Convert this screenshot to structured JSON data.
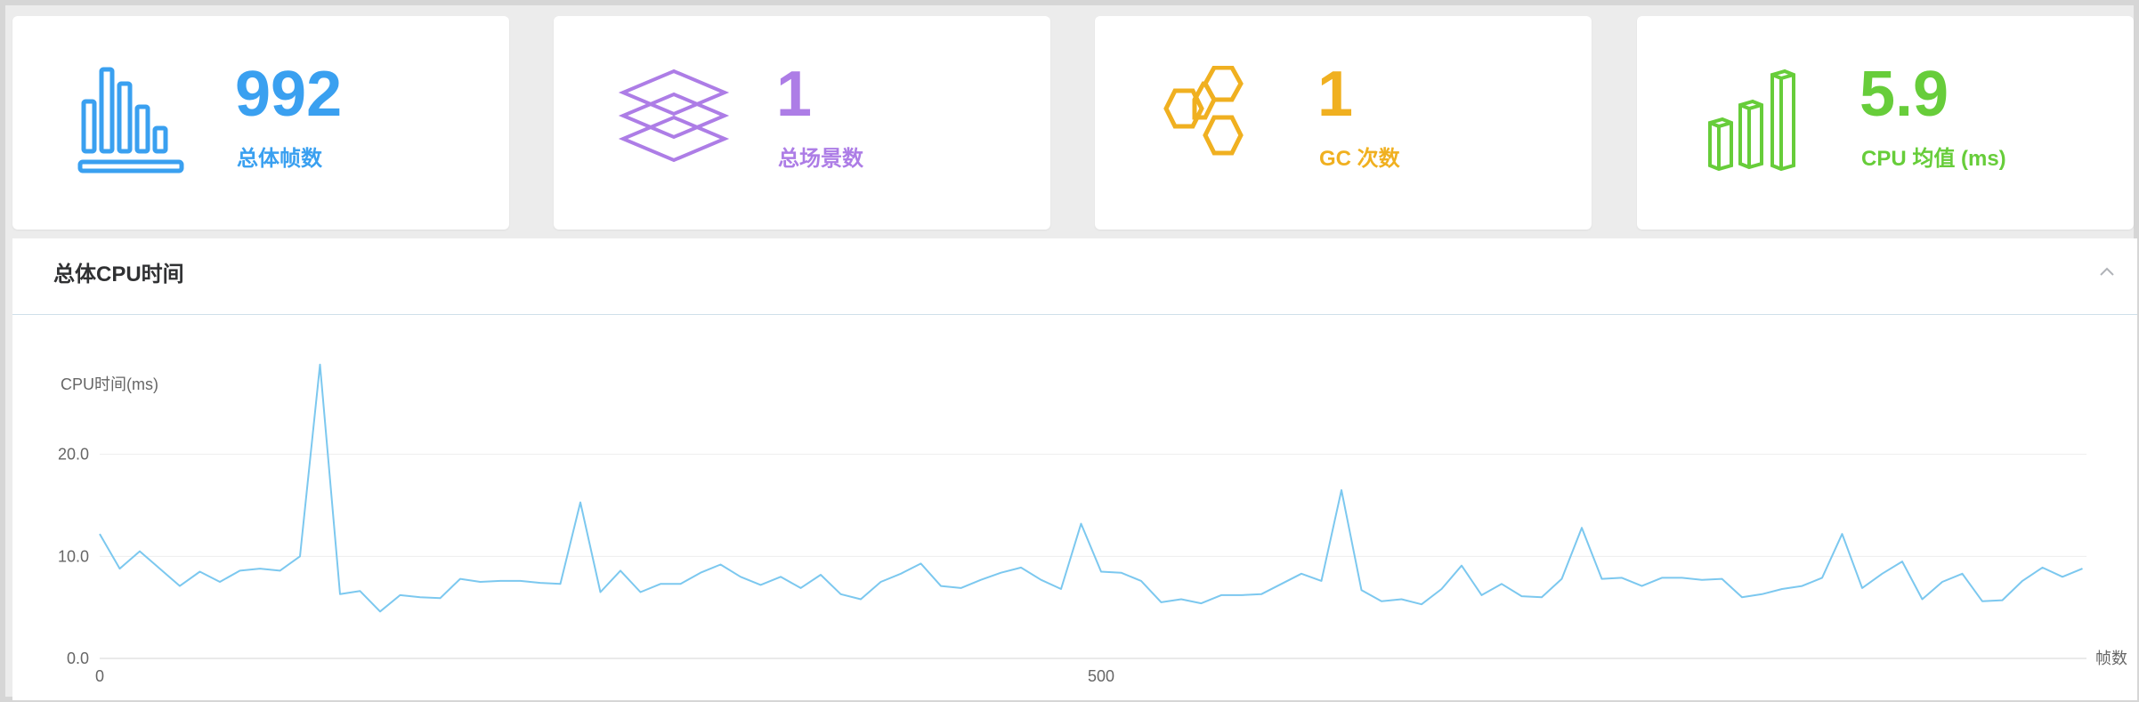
{
  "colors": {
    "blue": "#3aa0f0",
    "purple": "#ad7de6",
    "orange": "#f0b020",
    "green": "#67cd3a",
    "line": "#7cc8ef"
  },
  "stats": [
    {
      "value": "992",
      "label": "总体帧数",
      "icon": "bar-chart-icon",
      "color": "#3aa0f0"
    },
    {
      "value": "1",
      "label": "总场景数",
      "icon": "layers-icon",
      "color": "#ad7de6"
    },
    {
      "value": "1",
      "label": "GC 次数",
      "icon": "hexagons-icon",
      "color": "#f0b020"
    },
    {
      "value": "5.9",
      "label": "CPU 均值 (ms)",
      "icon": "3d-bars-icon",
      "color": "#67cd3a"
    }
  ],
  "panel": {
    "title": "总体CPU时间",
    "collapse_icon": "chevron-up-icon"
  },
  "chart_data": {
    "type": "line",
    "ylabel": "CPU时间(ms)",
    "xlabel": "帧数",
    "ylim": [
      0,
      30
    ],
    "yticks": [
      0,
      10,
      20
    ],
    "ytick_labels": [
      "0.0",
      "10.0",
      "20.0"
    ],
    "xlim": [
      0,
      992
    ],
    "xticks": [
      0,
      500
    ],
    "xtick_labels": [
      "0",
      "500"
    ],
    "grid": "horizontal",
    "series": [
      {
        "x": [
          0,
          10,
          20,
          30,
          40,
          50,
          60,
          70,
          80,
          90,
          100,
          110,
          120,
          130,
          140,
          150,
          160,
          170,
          180,
          190,
          200,
          210,
          220,
          230,
          240,
          250,
          260,
          270,
          280,
          290,
          300,
          310,
          320,
          330,
          340,
          350,
          360,
          370,
          380,
          390,
          400,
          410,
          420,
          430,
          440,
          450,
          460,
          470,
          480,
          490,
          500,
          510,
          520,
          530,
          540,
          550,
          560,
          570,
          580,
          590,
          600,
          610,
          620,
          630,
          640,
          650,
          660,
          670,
          680,
          690,
          700,
          710,
          720,
          730,
          740,
          750,
          760,
          770,
          780,
          790,
          800,
          810,
          820,
          830,
          840,
          850,
          860,
          870,
          880,
          890,
          900,
          910,
          920,
          930,
          940,
          950,
          960,
          970,
          980,
          990
        ],
        "y": [
          12.2,
          8.8,
          10.5,
          8.8,
          7.1,
          8.5,
          7.5,
          8.6,
          8.8,
          8.6,
          10.0,
          28.8,
          6.3,
          6.6,
          4.6,
          6.2,
          6.0,
          5.9,
          7.8,
          7.5,
          7.6,
          7.6,
          7.4,
          7.3,
          15.3,
          6.5,
          8.6,
          6.5,
          7.3,
          7.3,
          8.4,
          9.2,
          8.0,
          7.2,
          8.0,
          6.9,
          8.2,
          6.3,
          5.8,
          7.5,
          8.3,
          9.3,
          7.1,
          6.9,
          7.7,
          8.4,
          8.9,
          7.7,
          6.8,
          13.2,
          8.5,
          8.4,
          7.6,
          5.5,
          5.8,
          5.4,
          6.2,
          6.2,
          6.3,
          7.3,
          8.3,
          7.6,
          16.5,
          6.7,
          5.6,
          5.8,
          5.3,
          6.8,
          9.1,
          6.2,
          7.3,
          6.1,
          6.0,
          7.8,
          12.8,
          7.8,
          7.9,
          7.1,
          7.9,
          7.9,
          7.7,
          7.8,
          6.0,
          6.3,
          6.8,
          7.1,
          7.9,
          12.2,
          6.9,
          8.3,
          9.5,
          5.8,
          7.5,
          8.3,
          5.6,
          5.7,
          7.6,
          8.9,
          8.0,
          8.8
        ]
      }
    ]
  }
}
